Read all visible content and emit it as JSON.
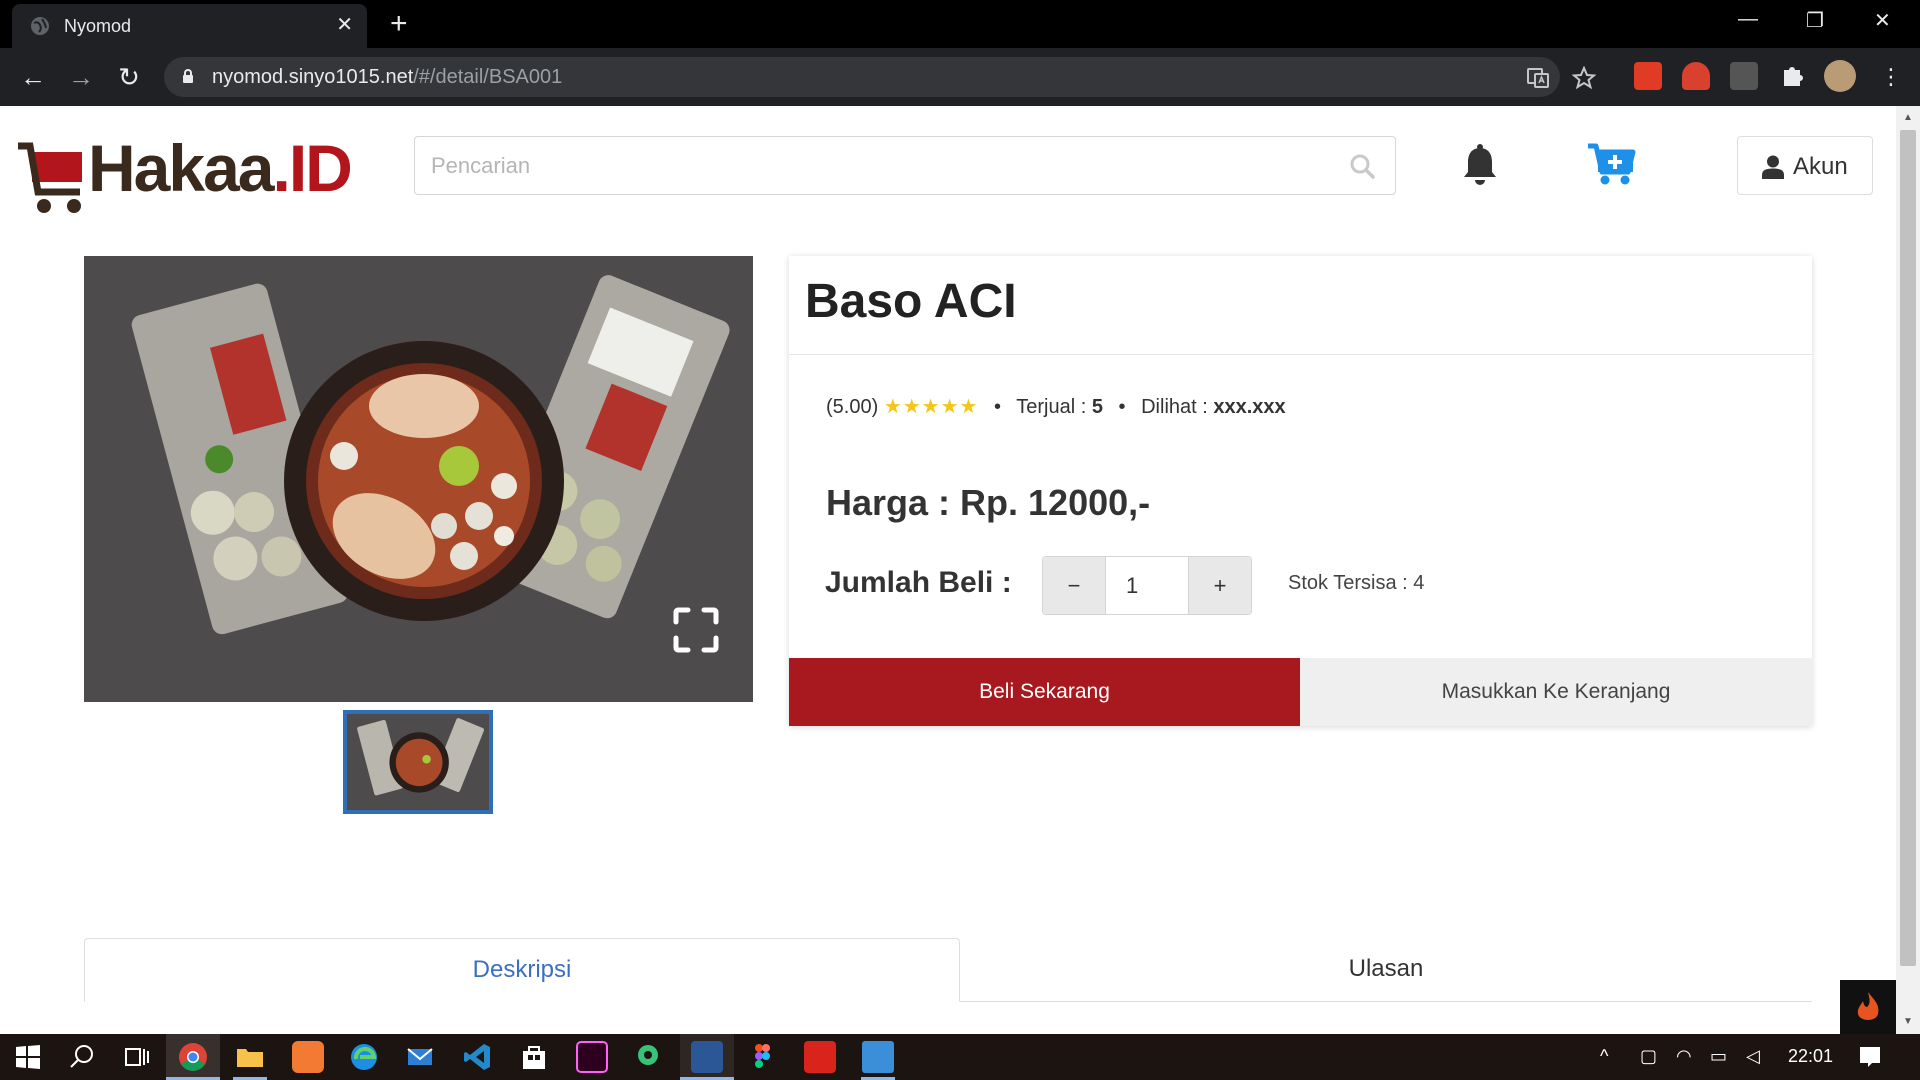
{
  "browser": {
    "tab_title": "Nyomod",
    "tab_close": "✕",
    "new_tab": "+",
    "url_host": "nyomod.sinyo1015.net",
    "url_path": "/#/detail/BSA001",
    "window_controls": {
      "minimize": "—",
      "restore": "❐",
      "close": "✕"
    },
    "nav": {
      "back": "←",
      "forward": "→",
      "reload": "↻"
    }
  },
  "header": {
    "logo_text_dark": "Ha",
    "logo_text_mid": "kaa",
    "logo_text_red": ".ID",
    "search_placeholder": "Pencarian",
    "account_label": "Akun"
  },
  "product": {
    "title": "Baso ACI",
    "rating_text": "(5.00)",
    "rating_value": 5,
    "stars": "★★★★★",
    "sold_label": "Terjual : ",
    "sold_value": "5",
    "views_label": "Dilihat : ",
    "views_value": "xxx.xxx",
    "price": "Harga : Rp. 12000,-",
    "quantity_label": "Jumlah Beli :",
    "quantity_minus": "−",
    "quantity_plus": "+",
    "quantity_value": "1",
    "stock": "Stok Tersisa : 4",
    "buy_now": "Beli Sekarang",
    "add_to_cart": "Masukkan Ke Keranjang"
  },
  "tabs": [
    {
      "label": "Deskripsi",
      "active": true
    },
    {
      "label": "Ulasan",
      "active": false
    }
  ],
  "taskbar": {
    "time": "22:01",
    "tray_chevron": "^"
  },
  "colors": {
    "brand_red": "#a8181f",
    "cart_blue": "#1e90e8",
    "link_blue": "#3c6fc4",
    "star_yellow": "#f5c518"
  },
  "icons": [
    "globe-icon",
    "lock-icon",
    "translate-icon",
    "star-bookmark-icon",
    "puzzle-icon",
    "search-icon",
    "bell-icon",
    "cart-plus-icon",
    "user-icon",
    "expand-icon",
    "fire-icon",
    "windows-icon"
  ]
}
